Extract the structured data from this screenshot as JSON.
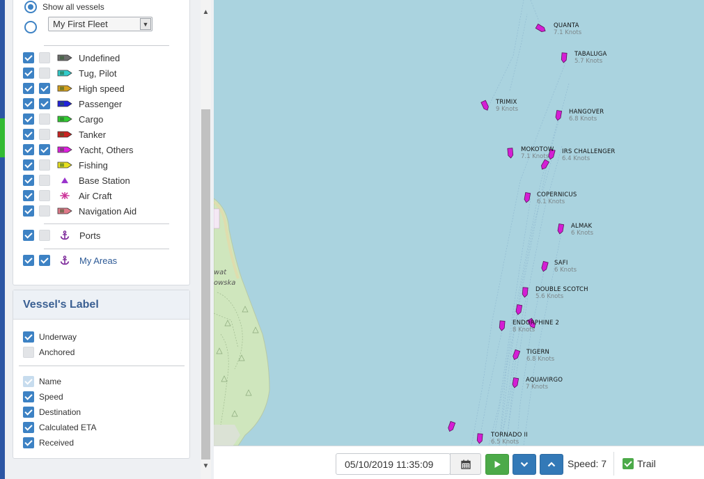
{
  "filters": {
    "show_all_label": "Show all vessels",
    "fleet_select_value": "My First Fleet",
    "vessel_types": [
      {
        "label": "Undefined",
        "color": "#6d6d6d",
        "visible": true,
        "labels": false
      },
      {
        "label": "Tug, Pilot",
        "color": "#33cccc",
        "visible": true,
        "labels": false
      },
      {
        "label": "High speed",
        "color": "#d4a020",
        "visible": true,
        "labels": true
      },
      {
        "label": "Passenger",
        "color": "#2222dd",
        "visible": true,
        "labels": true
      },
      {
        "label": "Cargo",
        "color": "#33cc33",
        "visible": true,
        "labels": false
      },
      {
        "label": "Tanker",
        "color": "#cc2222",
        "visible": true,
        "labels": false
      },
      {
        "label": "Yacht, Others",
        "color": "#e020e0",
        "visible": true,
        "labels": true
      },
      {
        "label": "Fishing",
        "color": "#e8e020",
        "visible": true,
        "labels": false
      },
      {
        "label": "Base Station",
        "color": "#9933cc",
        "visible": true,
        "labels": false
      },
      {
        "label": "Air Craft",
        "color": "#cc3399",
        "visible": true,
        "labels": false
      },
      {
        "label": "Navigation Aid",
        "color": "#e07a8a",
        "visible": true,
        "labels": false
      }
    ],
    "ports_label": "Ports",
    "my_areas_label": "My Areas"
  },
  "vessel_label": {
    "title": "Vessel's Label",
    "underway": "Underway",
    "anchored": "Anchored",
    "fields": [
      "Name",
      "Speed",
      "Destination",
      "Calculated ETA",
      "Received"
    ]
  },
  "map": {
    "vessels": [
      {
        "name": "QUANTA",
        "speed": "7.1 Knots"
      },
      {
        "name": "TABALUGA",
        "speed": "5.7 Knots"
      },
      {
        "name": "TRIMIX",
        "speed": "9 Knots"
      },
      {
        "name": "HANGOVER",
        "speed": "6.8 Knots"
      },
      {
        "name": "MOKOTOW",
        "speed": "7.1 Knots"
      },
      {
        "name": "IRS CHALLENGER",
        "speed": "6.4 Knots"
      },
      {
        "name": "COPERNICUS",
        "speed": "6.1 Knots"
      },
      {
        "name": "ALMAK",
        "speed": "6 Knots"
      },
      {
        "name": "SAFI",
        "speed": "6 Knots"
      },
      {
        "name": "DOUBLE SCOTCH",
        "speed": "5.6 Knots"
      },
      {
        "name": "ENDORPHINE 2",
        "speed": "8 Knots"
      },
      {
        "name": "TIGERN",
        "speed": "6.8 Knots"
      },
      {
        "name": "AQUAVIRGO",
        "speed": "7 Knots"
      },
      {
        "name": "TORNADO II",
        "speed": "6.5 Knots"
      }
    ],
    "land_labels": [
      "wat",
      "owska"
    ],
    "vessel_color": "#d41ed4",
    "water_color": "#aad3df",
    "land_color": "#cfe6bd"
  },
  "playback": {
    "datetime": "05/10/2019 11:35:09",
    "speed_label": "Speed: 7",
    "trail_label": "Trail"
  }
}
